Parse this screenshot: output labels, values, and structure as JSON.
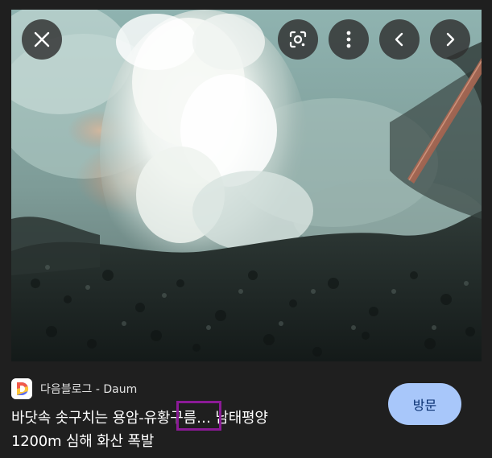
{
  "image": {
    "alt_icon": "photo"
  },
  "controls": {
    "close_icon": "close-icon",
    "lens_icon": "google-lens-icon",
    "more_icon": "more-vertical-icon",
    "prev_icon": "chevron-left-icon",
    "next_icon": "chevron-right-icon"
  },
  "source": {
    "favicon_letter": "D",
    "name": "다음블로그 - Daum"
  },
  "title": {
    "line1": "바닷속 솟구치는 용암-유황구름… 남태평양",
    "line2": "1200m 심해 화산 폭발"
  },
  "visit_button": {
    "label": "방문"
  },
  "colors": {
    "background": "#1f1f1f",
    "visit_button_bg": "#a8c7fa",
    "highlight": "#8b1a96"
  }
}
